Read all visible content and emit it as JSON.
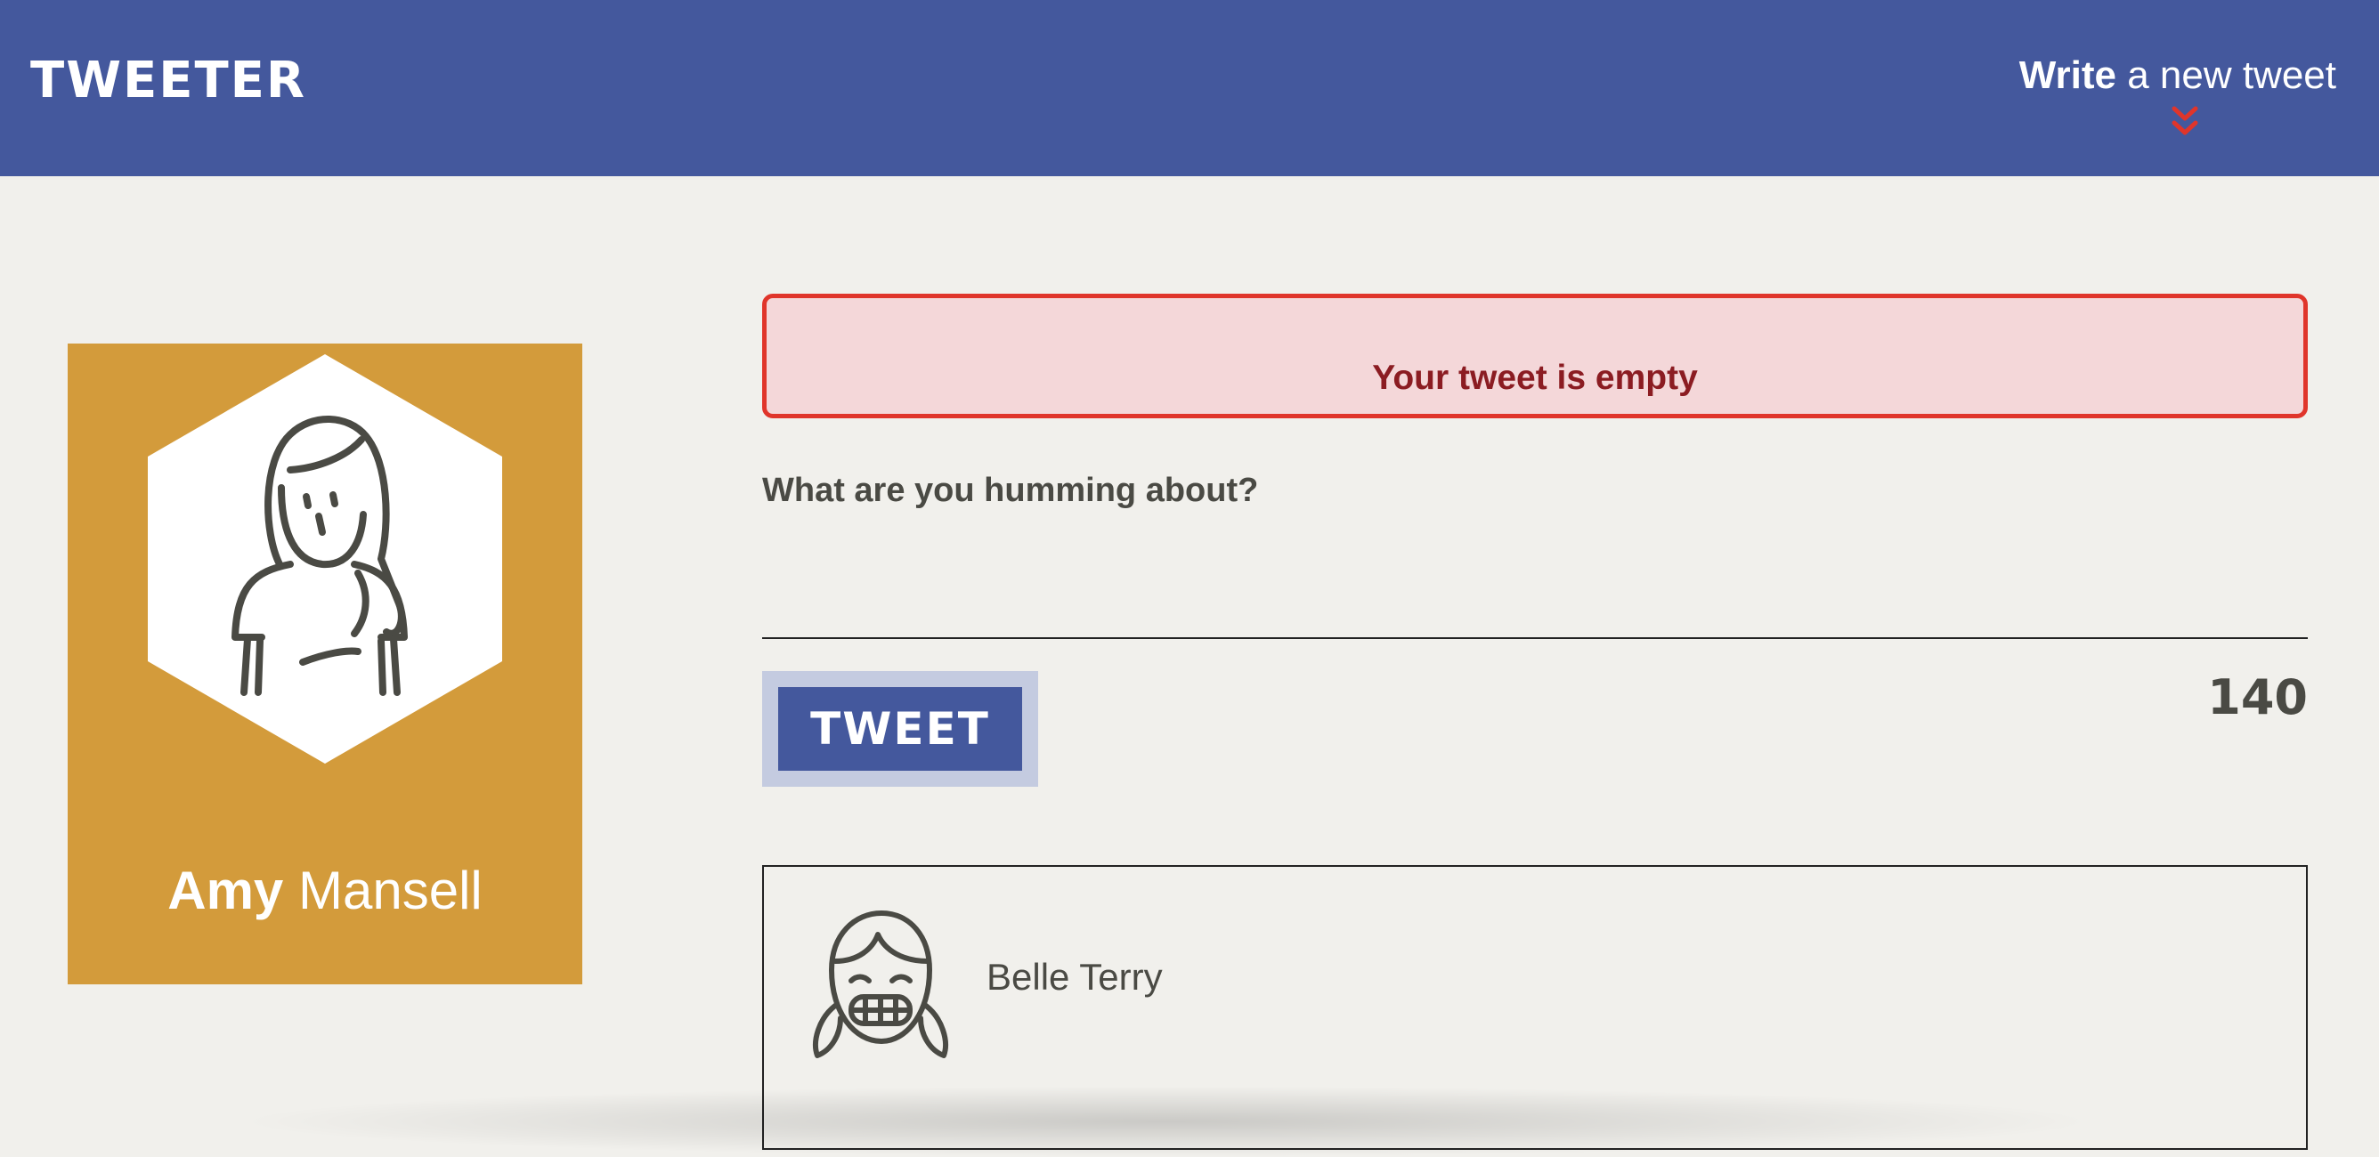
{
  "nav": {
    "brand": "TWEETER",
    "compose_bold": "Write",
    "compose_rest": " a new tweet",
    "compose_icon": "double-chevron-down-icon"
  },
  "profile": {
    "first_name": "Amy",
    "last_name": " Mansell",
    "avatar_icon": "user-avatar-icon",
    "card_color": "#d39b3b"
  },
  "composer": {
    "error_message": "Your tweet is empty",
    "label": "What are you humming about?",
    "input_value": "",
    "button_label": "TWEET",
    "char_counter": "140"
  },
  "tweets": [
    {
      "author": "Belle Terry",
      "avatar_icon": "smiling-girl-avatar-icon"
    }
  ],
  "colors": {
    "nav_bg": "#44589d",
    "page_bg": "#f1f0ec",
    "error_border": "#e0352b",
    "error_bg": "#f4d7d9",
    "error_text": "#8b1c22"
  }
}
